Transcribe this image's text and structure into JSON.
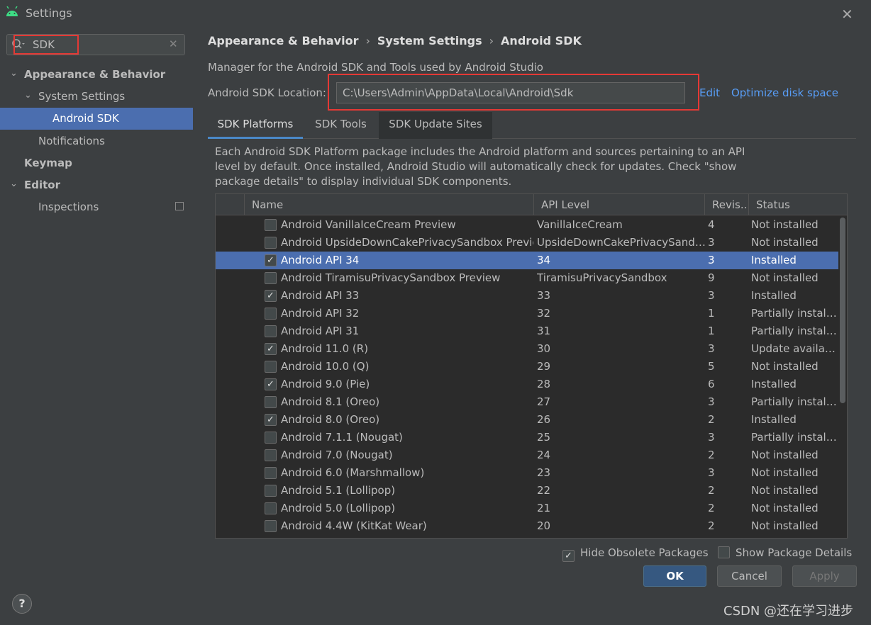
{
  "window": {
    "title": "Settings",
    "close_glyph": "✕"
  },
  "search": {
    "value": "SDK",
    "clear_glyph": "✕"
  },
  "sidebar": {
    "items": [
      {
        "label": "Appearance & Behavior",
        "chevron": "⌄"
      },
      {
        "label": "System Settings",
        "chevron": "⌄"
      },
      {
        "label": "Android SDK"
      },
      {
        "label": "Notifications"
      },
      {
        "label": "Keymap"
      },
      {
        "label": "Editor",
        "chevron": "⌄"
      },
      {
        "label": "Inspections"
      }
    ]
  },
  "breadcrumb": {
    "items": [
      "Appearance & Behavior",
      "System Settings",
      "Android SDK"
    ],
    "separator": "›"
  },
  "main": {
    "description": "Manager for the Android SDK and Tools used by Android Studio",
    "location_label": "Android SDK Location:",
    "location_value": "C:\\Users\\Admin\\AppData\\Local\\Android\\Sdk",
    "edit_link": "Edit",
    "optimize_link": "Optimize disk space",
    "tabs": [
      "SDK Platforms",
      "SDK Tools",
      "SDK Update Sites"
    ],
    "info": "Each Android SDK Platform package includes the Android platform and sources pertaining to an API level by default. Once installed, Android Studio will automatically check for updates. Check \"show package details\" to display individual SDK components."
  },
  "table": {
    "headers": [
      "Name",
      "API Level",
      "Revis...",
      "Status"
    ],
    "rows": [
      {
        "name": "Android VanillaIceCream Preview",
        "api": "VanillaIceCream",
        "rev": "4",
        "status": "Not installed",
        "checked": false
      },
      {
        "name": "Android UpsideDownCakePrivacySandbox Preview",
        "api": "UpsideDownCakePrivacySandb...",
        "rev": "3",
        "status": "Not installed",
        "checked": false
      },
      {
        "name": "Android API 34",
        "api": "34",
        "rev": "3",
        "status": "Installed",
        "checked": true,
        "selected": true
      },
      {
        "name": "Android TiramisuPrivacySandbox Preview",
        "api": "TiramisuPrivacySandbox",
        "rev": "9",
        "status": "Not installed",
        "checked": false
      },
      {
        "name": "Android API 33",
        "api": "33",
        "rev": "3",
        "status": "Installed",
        "checked": true
      },
      {
        "name": "Android API 32",
        "api": "32",
        "rev": "1",
        "status": "Partially install...",
        "checked": false
      },
      {
        "name": "Android API 31",
        "api": "31",
        "rev": "1",
        "status": "Partially install...",
        "checked": false
      },
      {
        "name": "Android 11.0 (R)",
        "api": "30",
        "rev": "3",
        "status": "Update availab...",
        "checked": true
      },
      {
        "name": "Android 10.0 (Q)",
        "api": "29",
        "rev": "5",
        "status": "Not installed",
        "checked": false
      },
      {
        "name": "Android 9.0 (Pie)",
        "api": "28",
        "rev": "6",
        "status": "Installed",
        "checked": true
      },
      {
        "name": "Android 8.1 (Oreo)",
        "api": "27",
        "rev": "3",
        "status": "Partially install...",
        "checked": false
      },
      {
        "name": "Android 8.0 (Oreo)",
        "api": "26",
        "rev": "2",
        "status": "Installed",
        "checked": true
      },
      {
        "name": "Android 7.1.1 (Nougat)",
        "api": "25",
        "rev": "3",
        "status": "Partially install...",
        "checked": false
      },
      {
        "name": "Android 7.0 (Nougat)",
        "api": "24",
        "rev": "2",
        "status": "Not installed",
        "checked": false
      },
      {
        "name": "Android 6.0 (Marshmallow)",
        "api": "23",
        "rev": "3",
        "status": "Not installed",
        "checked": false
      },
      {
        "name": "Android 5.1 (Lollipop)",
        "api": "22",
        "rev": "2",
        "status": "Not installed",
        "checked": false
      },
      {
        "name": "Android 5.0 (Lollipop)",
        "api": "21",
        "rev": "2",
        "status": "Not installed",
        "checked": false
      },
      {
        "name": "Android 4.4W (KitKat Wear)",
        "api": "20",
        "rev": "2",
        "status": "Not installed",
        "checked": false
      }
    ]
  },
  "options": {
    "hide_obsolete": {
      "label": "Hide Obsolete Packages",
      "checked": true
    },
    "show_details": {
      "label": "Show Package Details",
      "checked": false
    }
  },
  "footer": {
    "help": "?",
    "ok": "OK",
    "cancel": "Cancel",
    "apply": "Apply",
    "watermark": "CSDN @还在学习进步"
  },
  "colors": {
    "accent": "#4b6eaf",
    "link": "#589df6",
    "highlight_box": "#e53935",
    "background": "#3c3f41"
  },
  "icons": {
    "app": "android-icon",
    "search": "search-icon",
    "check": "✓"
  }
}
